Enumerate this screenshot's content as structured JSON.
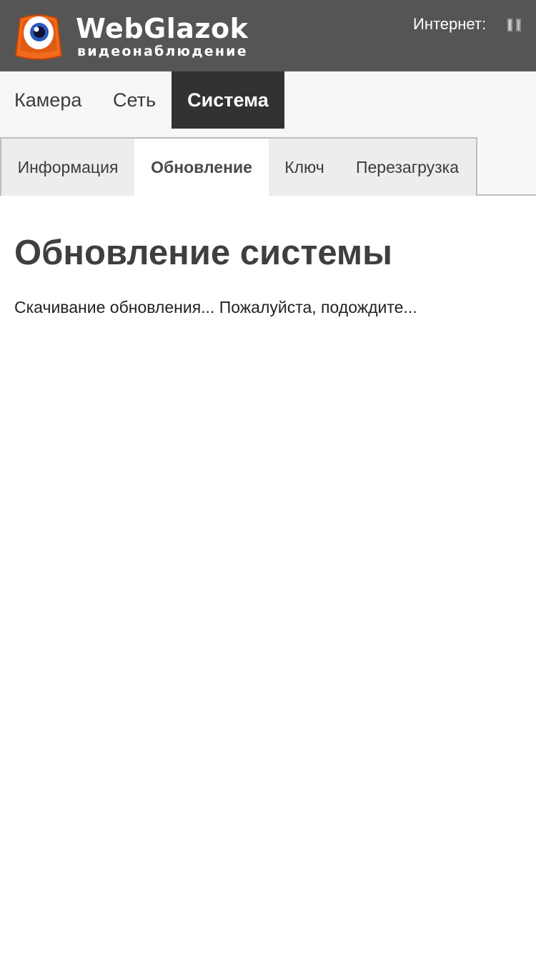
{
  "header": {
    "brand": "WebGlazok",
    "tagline": "видеонаблюдение",
    "internet_label": "Интернет:",
    "logo_icon": "camera-eye-logo-icon",
    "signal_icon": "signal-strength-icon"
  },
  "main_nav": {
    "items": [
      {
        "label": "Камера"
      },
      {
        "label": "Сеть"
      },
      {
        "label": "Система"
      }
    ],
    "active": "Система"
  },
  "sub_nav": {
    "tabs": [
      {
        "label": "Информация"
      },
      {
        "label": "Обновление"
      },
      {
        "label": "Ключ"
      },
      {
        "label": "Перезагрузка"
      }
    ],
    "active": "Обновление"
  },
  "content": {
    "title": "Обновление системы",
    "status": "Скачивание обновления... Пожалуйста, подождите..."
  },
  "colors": {
    "header_bg": "#555555",
    "active_main_tab_bg": "#323232",
    "brand_orange": "#f26a1b"
  }
}
